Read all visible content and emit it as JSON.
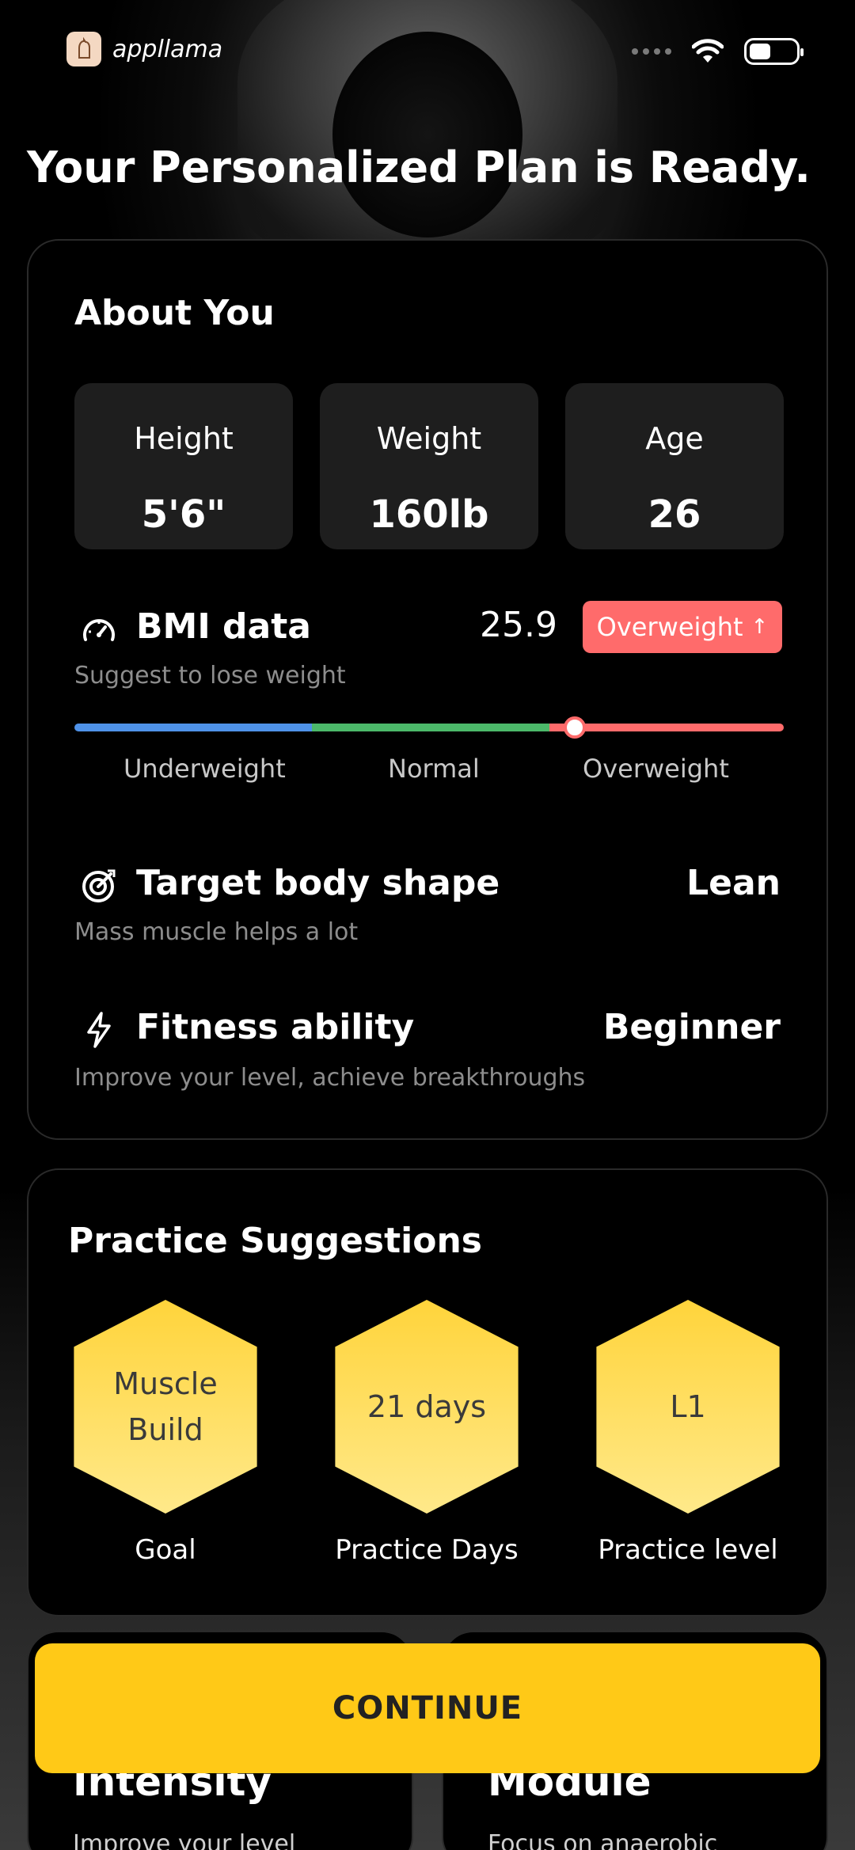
{
  "app": {
    "logo_text": "appllama"
  },
  "page_title": "Your Personalized Plan is Ready.",
  "about": {
    "title": "About You",
    "stats": [
      {
        "label": "Height",
        "value": "5'6\""
      },
      {
        "label": "Weight",
        "value": "160lb"
      },
      {
        "label": "Age",
        "value": "26"
      }
    ],
    "bmi": {
      "title": "BMI data",
      "subtitle": "Suggest to lose weight",
      "value": "25.9",
      "status": "Overweight",
      "status_arrow": "↑",
      "scale_labels": [
        "Underweight",
        "Normal",
        "Overweight"
      ],
      "colors": {
        "underweight": "#4f92e8",
        "normal": "#4cb96a",
        "overweight": "#ff6b6b"
      },
      "marker_position": 0.705
    },
    "target": {
      "title": "Target body shape",
      "subtitle": "Mass muscle helps a lot",
      "value": "Lean"
    },
    "fitness": {
      "title": "Fitness ability",
      "subtitle": "Improve your level, achieve breakthroughs",
      "value": "Beginner"
    }
  },
  "practice": {
    "title": "Practice Suggestions",
    "items": [
      {
        "value": "Muscle Build",
        "label": "Goal"
      },
      {
        "value": "21 days",
        "label": "Practice Days"
      },
      {
        "value": "L1",
        "label": "Practice level"
      }
    ]
  },
  "peek_cards": [
    {
      "title": "Intensity",
      "subtitle": "Improve your level"
    },
    {
      "title": "Module",
      "subtitle": "Focus on anaerobic"
    }
  ],
  "cta": {
    "label": "CONTINUE",
    "color": "#ffc917"
  }
}
